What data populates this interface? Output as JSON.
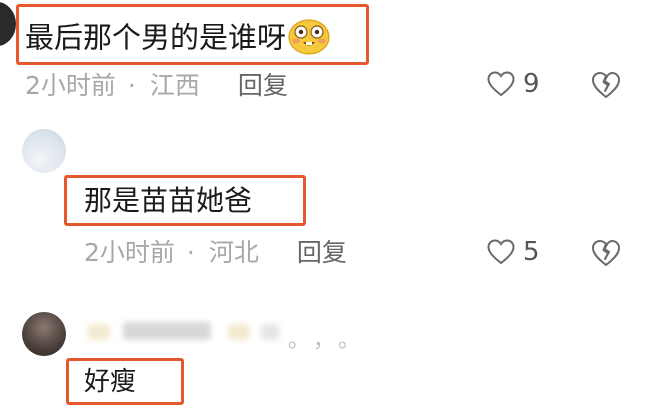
{
  "comments": [
    {
      "text": "最后那个男的是谁呀",
      "emoji": "blush-laugh-emoji",
      "time": "2小时前",
      "separator": "·",
      "location": "江西",
      "reply_label": "回复",
      "likes": "9"
    },
    {
      "text": "那是苗苗她爸",
      "time": "2小时前",
      "separator": "·",
      "location": "河北",
      "reply_label": "回复",
      "likes": "5"
    },
    {
      "text": "好瘦",
      "blurred_header": "。，。"
    }
  ],
  "colors": {
    "highlight": "#e5572c",
    "meta": "#a8a8a8",
    "text": "#1a1a1a"
  },
  "icons": [
    "heart-outline-icon",
    "broken-heart-icon"
  ]
}
